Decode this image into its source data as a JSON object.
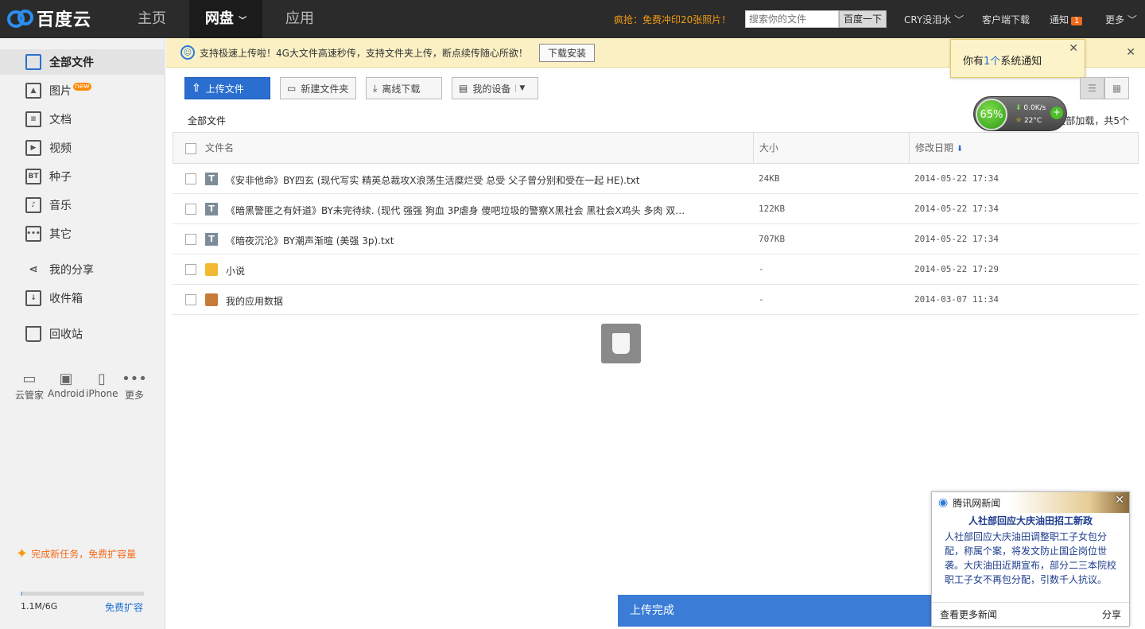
{
  "topbar": {
    "logo_text": "百度云",
    "nav": [
      "主页",
      "网盘",
      "应用"
    ],
    "promo": "疯抢：免费冲印20张照片！",
    "search_placeholder": "搜索你的文件",
    "search_button": "百度一下",
    "user": "CRY没泪水",
    "client_download": "客户端下载",
    "notifications": "通知",
    "notification_count": "1",
    "more": "更多"
  },
  "sidebar": {
    "items": [
      {
        "label": "全部文件",
        "icon": "all-files-icon"
      },
      {
        "label": "图片",
        "icon": "image-icon",
        "badge": "new"
      },
      {
        "label": "文档",
        "icon": "document-icon"
      },
      {
        "label": "视频",
        "icon": "video-icon"
      },
      {
        "label": "种子",
        "icon": "torrent-icon",
        "glyph": "BT"
      },
      {
        "label": "音乐",
        "icon": "music-icon"
      },
      {
        "label": "其它",
        "icon": "other-icon"
      },
      {
        "label": "我的分享",
        "icon": "share-icon"
      },
      {
        "label": "收件箱",
        "icon": "inbox-icon"
      },
      {
        "label": "回收站",
        "icon": "trash-icon"
      }
    ],
    "devices": [
      "云管家",
      "Android",
      "iPhone",
      "更多"
    ],
    "mission": "完成新任务，免费扩容量",
    "quota": "1.1M/6G",
    "quota_link": "免费扩容"
  },
  "notice": {
    "text": "支持极速上传啦！4G大文件高速秒传，支持文件夹上传，断点续传随心所欲！",
    "button": "下载安装"
  },
  "system_notice": {
    "prefix": "你有",
    "count": "1个",
    "suffix": "系统通知"
  },
  "toolbar": {
    "upload": "上传文件",
    "new_folder": "新建文件夹",
    "offline_download": "离线下载",
    "my_devices": "我的设备"
  },
  "breadcrumb": "全部文件",
  "loaded_text": "已全部加载，共5个",
  "speed_widget": {
    "percent": "65%",
    "speed": "0.0K/s",
    "temp": "22°C"
  },
  "table": {
    "columns": [
      "文件名",
      "大小",
      "修改日期"
    ],
    "rows": [
      {
        "name": "《安非他命》BY四玄 (现代写实 精英总裁攻X浪荡生活糜烂受 总受 父子曾分别和受在一起 HE).txt",
        "size": "24KB",
        "date": "2014-05-22 17:34",
        "type": "txt"
      },
      {
        "name": "《暗黑警匪之有奸道》BY未完待续. (现代 强强 狗血 3P虐身 傻吧垃圾的警察X黑社会 黑社会X鸡头 多肉 双…",
        "size": "122KB",
        "date": "2014-05-22 17:34",
        "type": "txt"
      },
      {
        "name": "《暗夜沉沦》BY潮声渐暄 (美强 3p).txt",
        "size": "707KB",
        "date": "2014-05-22 17:34",
        "type": "txt"
      },
      {
        "name": "小说",
        "size": "-",
        "date": "2014-05-22 17:29",
        "type": "folder"
      },
      {
        "name": "我的应用数据",
        "size": "-",
        "date": "2014-03-07 11:34",
        "type": "app"
      }
    ]
  },
  "upload_done": "上传完成",
  "news": {
    "source": "腾讯网新闻",
    "title": "人社部回应大庆油田招工新政",
    "body": "人社部回应大庆油田调整职工子女包分配，称属个案，将发文防止国企岗位世袭。大庆油田近期宣布，部分二三本院校职工子女不再包分配，引数千人抗议。",
    "more": "查看更多新闻",
    "share": "分享"
  }
}
